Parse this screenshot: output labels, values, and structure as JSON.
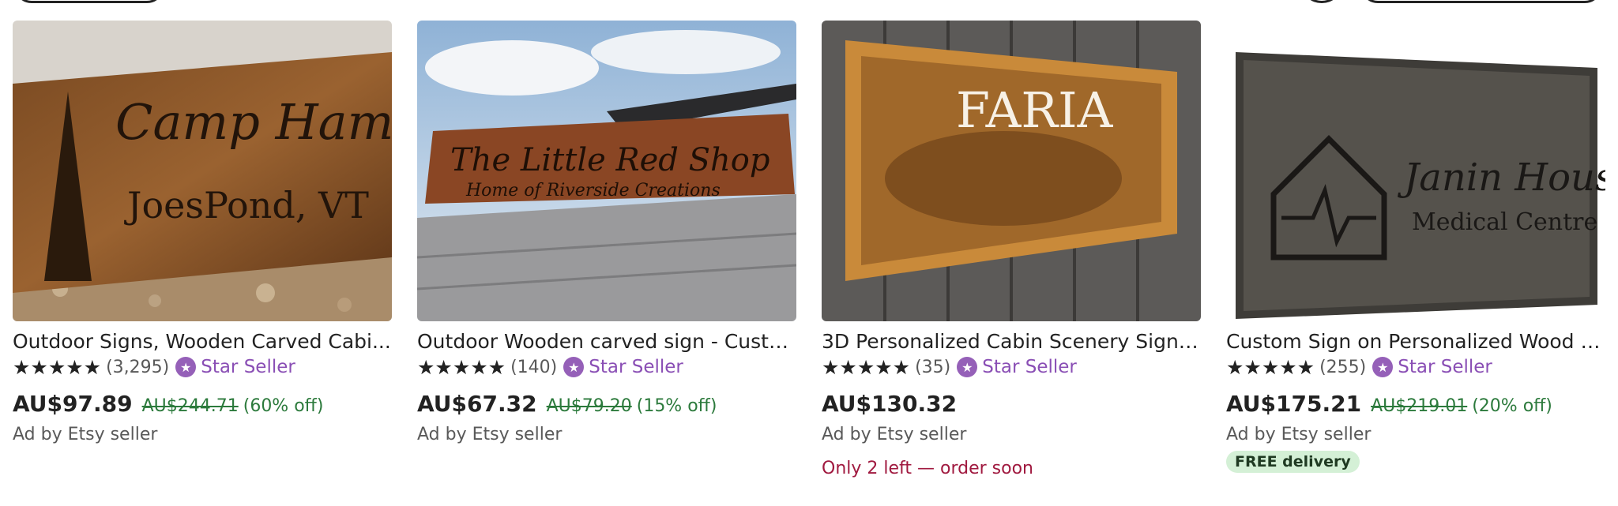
{
  "listings": [
    {
      "title": "Outdoor Signs, Wooden Carved Cabi...",
      "stars": "★★★★★",
      "reviews": "(3,295)",
      "badge": "Star Seller",
      "price": "AU$97.89",
      "original_price": "AU$244.71",
      "discount": "(60% off)",
      "ad_label": "Ad by Etsy seller",
      "image_text": [
        "Camp Hamilto",
        "JoesPond, VT"
      ]
    },
    {
      "title": "Outdoor Wooden carved sign - Custo...",
      "stars": "★★★★★",
      "reviews": "(140)",
      "badge": "Star Seller",
      "price": "AU$67.32",
      "original_price": "AU$79.20",
      "discount": "(15% off)",
      "ad_label": "Ad by Etsy seller",
      "image_text": [
        "The Little Red Shop",
        "Home of Riverside Creations"
      ]
    },
    {
      "title": "3D Personalized Cabin Scenery Sign ...",
      "stars": "★★★★★",
      "reviews": "(35)",
      "badge": "Star Seller",
      "price": "AU$130.32",
      "ad_label": "Ad by Etsy seller",
      "urgency": "Only 2 left — order soon",
      "image_text": [
        "FARIA"
      ]
    },
    {
      "title": "Custom Sign on Personalized Wood S...",
      "stars": "★★★★★",
      "reviews": "(255)",
      "badge": "Star Seller",
      "price": "AU$175.21",
      "original_price": "AU$219.01",
      "discount": "(20% off)",
      "ad_label": "Ad by Etsy seller",
      "delivery_badge": "FREE delivery",
      "image_text": [
        "Janin House",
        "Medical Centre"
      ]
    }
  ],
  "colors": {
    "star_seller": "#8a4fb5",
    "discount_green": "#2c7a3c",
    "urgency_red": "#a0193f",
    "delivery_bg": "#d4f0d6"
  }
}
